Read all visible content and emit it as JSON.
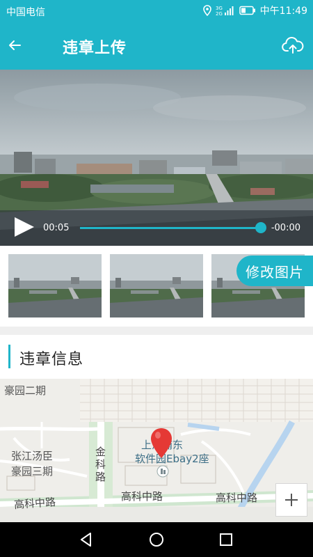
{
  "status_bar": {
    "carrier": "中国电信",
    "network": "3G 2G",
    "time": "中午11:49",
    "icons": [
      "location-icon",
      "signal-icon",
      "battery-icon"
    ]
  },
  "header": {
    "title": "违章上传",
    "back_icon": "arrow-left-icon",
    "upload_icon": "cloud-upload-icon"
  },
  "video": {
    "current_time": "00:05",
    "remaining_time": "-00:00",
    "progress": 1.0,
    "play_icon": "play-icon"
  },
  "thumbnails": {
    "count": 3,
    "edit_label": "修改图片"
  },
  "section": {
    "title": "违章信息"
  },
  "map": {
    "labels": {
      "haoyuan2": "豪园二期",
      "zhangjiang": "张江汤臣",
      "haoyuan3": "豪园三期",
      "jinke": "金\n科\n路",
      "gaoke_left": "高科中路",
      "gaoke_mid": "高科中路",
      "gaoke_right": "高科中路",
      "poi_line1": "上海浦东",
      "poi_line2": "软件园Ebay2座"
    },
    "zoom_in_icon": "plus-icon"
  },
  "colors": {
    "accent": "#1fb5c9",
    "pin": "#e53935",
    "nav_bar": "#000000"
  },
  "nav": {
    "icons": [
      "back-triangle-icon",
      "home-circle-icon",
      "recents-square-icon"
    ]
  }
}
